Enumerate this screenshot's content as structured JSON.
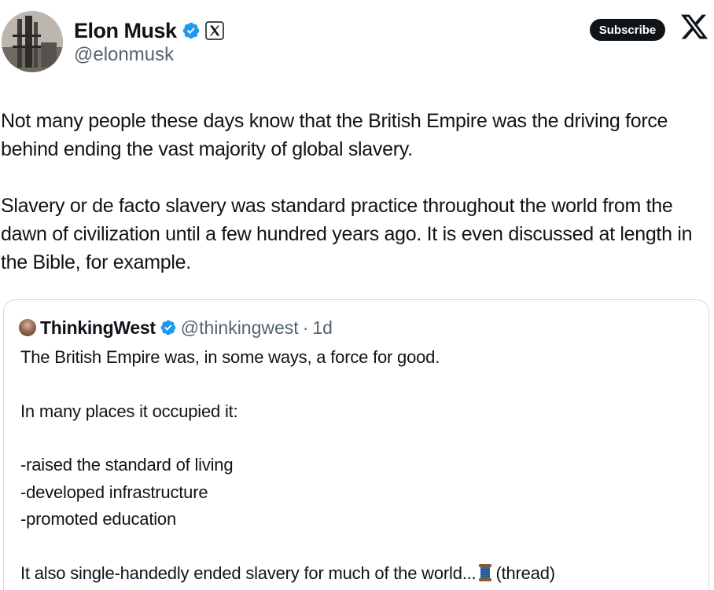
{
  "author": {
    "display_name": "Elon Musk",
    "handle": "@elonmusk"
  },
  "header": {
    "subscribe_label": "Subscribe"
  },
  "tweet": {
    "paragraphs": [
      "Not many people these days know that the British Empire was the driving force behind ending the vast majority of global slavery.",
      "Slavery or de facto slavery was standard practice throughout the world from the dawn of civilization until a few hundred years ago. It is even discussed at length in the Bible, for example."
    ]
  },
  "quote": {
    "display_name": "ThinkingWest",
    "handle": "@thinkingwest",
    "separator": "·",
    "time": "1d",
    "line1": "The British Empire was, in some ways, a force for good.",
    "line2": "In many places it occupied it:",
    "bullets": [
      "-raised the standard of living",
      "-developed infrastructure",
      "-promoted education"
    ],
    "last_line_text": "It also single-handedly ended slavery for much of the world...",
    "last_line_suffix": "(thread)"
  },
  "icons": {
    "verified": "verified-badge-icon",
    "affiliate": "x-affiliate-badge-icon",
    "brand": "x-logo-icon",
    "emoji": "spool-of-thread-icon"
  },
  "colors": {
    "verified_blue": "#1d9bf0",
    "text_primary": "#0f1419",
    "text_secondary": "#536471",
    "border": "#cfd9de"
  }
}
